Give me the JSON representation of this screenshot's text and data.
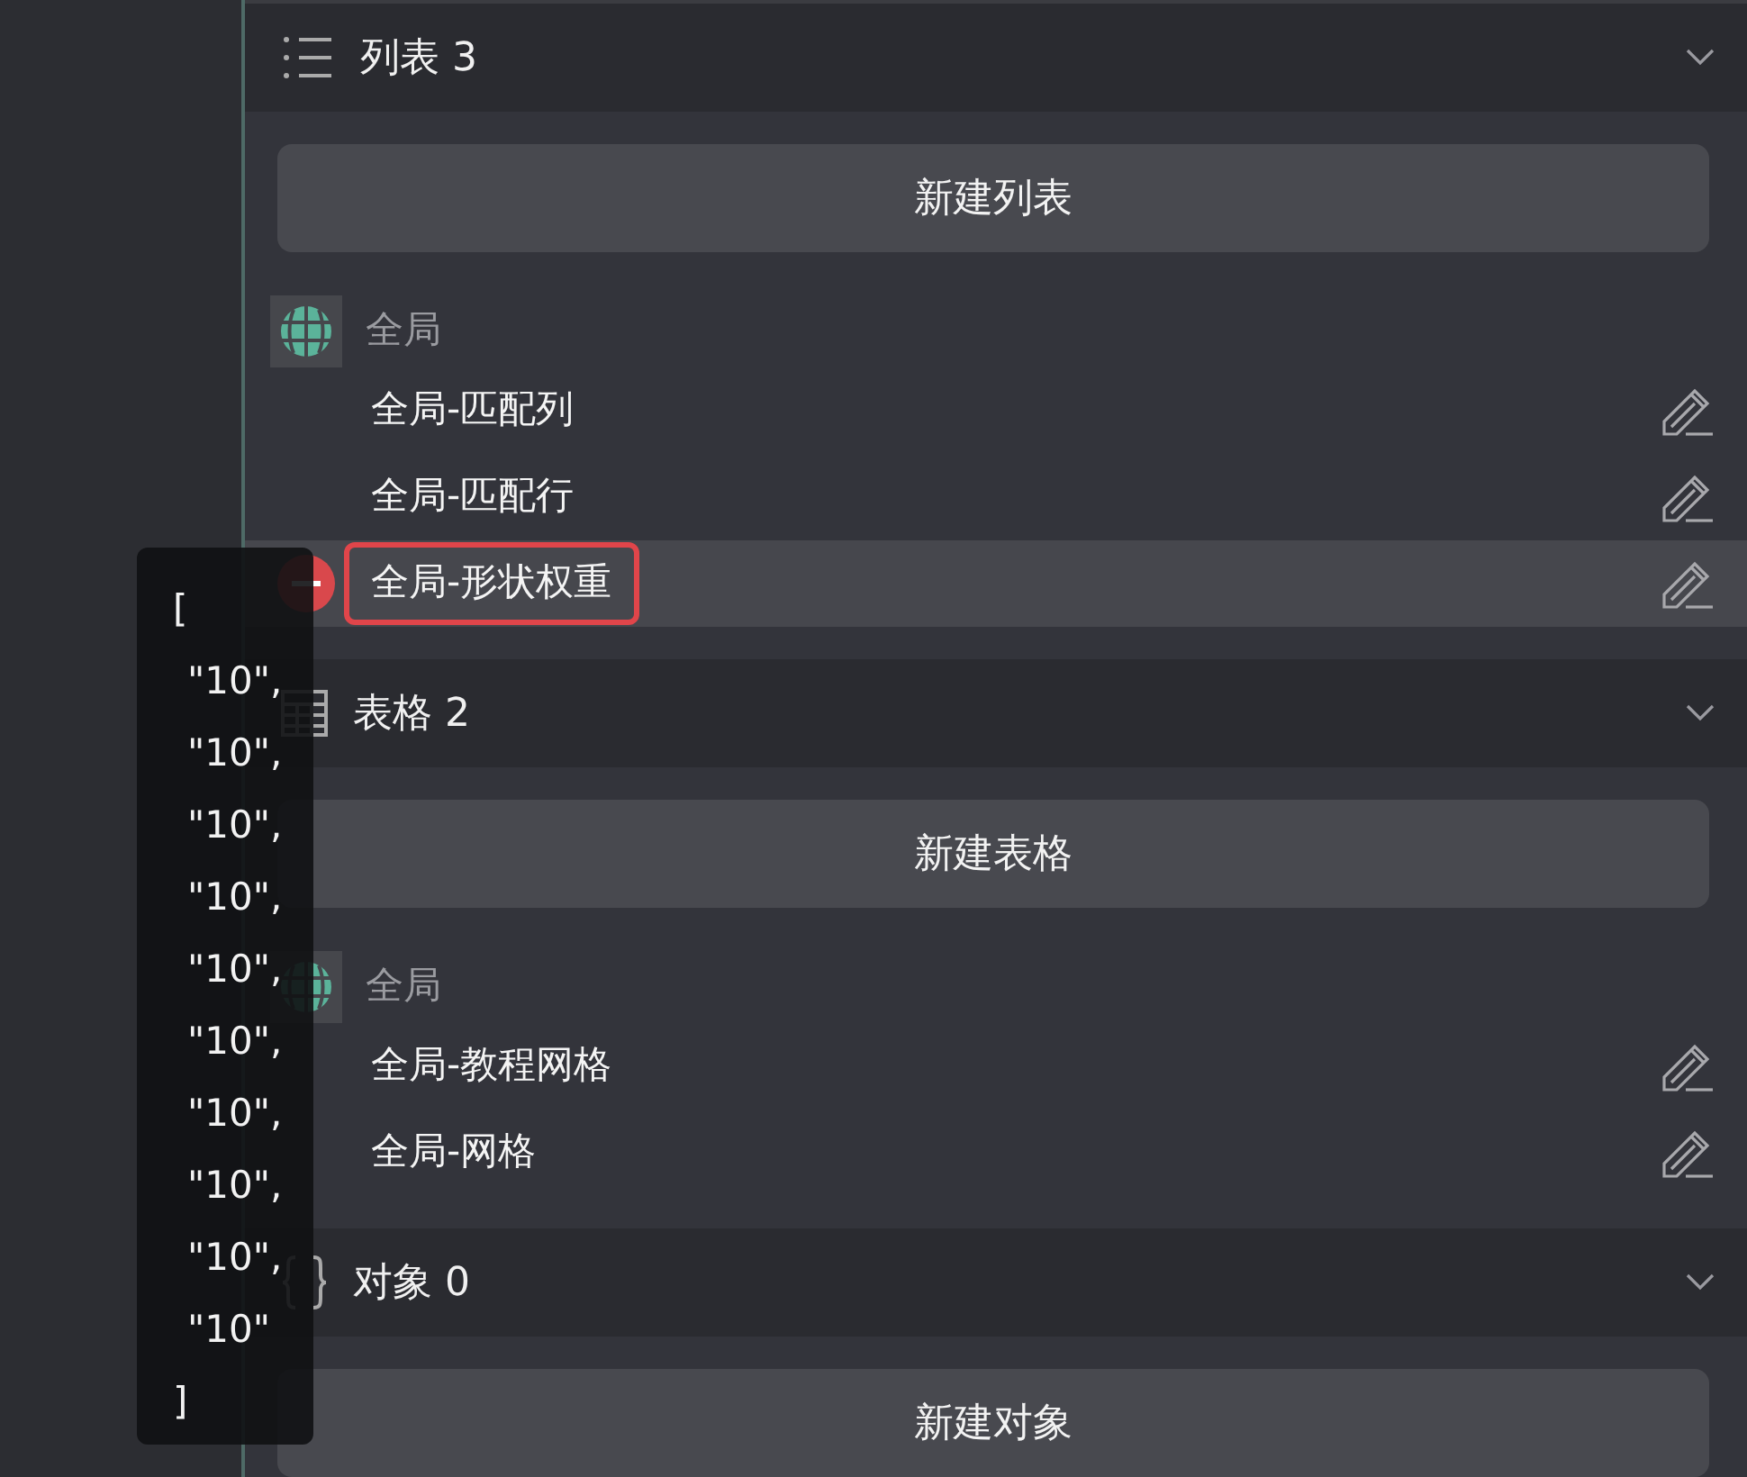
{
  "sections": [
    {
      "kind": "list",
      "title": "列表 3",
      "button": "新建列表",
      "group": "全局",
      "items": [
        {
          "label": "全局-匹配列",
          "selected": false,
          "highlighted": false
        },
        {
          "label": "全局-匹配行",
          "selected": false,
          "highlighted": false
        },
        {
          "label": "全局-形状权重",
          "selected": true,
          "highlighted": true
        }
      ]
    },
    {
      "kind": "table",
      "title": "表格 2",
      "button": "新建表格",
      "group": "全局",
      "items": [
        {
          "label": "全局-教程网格",
          "selected": false,
          "highlighted": false
        },
        {
          "label": "全局-网格",
          "selected": false,
          "highlighted": false
        }
      ]
    },
    {
      "kind": "object",
      "title": "对象 0",
      "button": "新建对象"
    }
  ],
  "tooltip": {
    "lines": [
      "[",
      "\"10\",",
      "\"10\",",
      "\"10\",",
      "\"10\",",
      "\"10\",",
      "\"10\",",
      "\"10\",",
      "\"10\",",
      "\"10\",",
      "\"10\"",
      "]"
    ]
  }
}
